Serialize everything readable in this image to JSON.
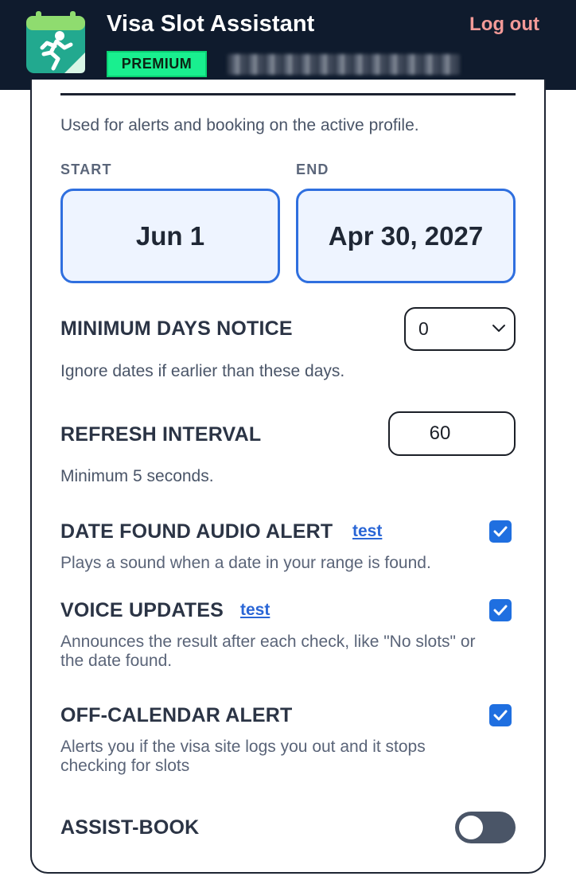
{
  "header": {
    "app_title": "Visa Slot Assistant",
    "badge": "PREMIUM",
    "logout_label": "Log out",
    "logo_icon": "runner-calendar-icon",
    "colors": {
      "background": "#0f1b2d",
      "badge": "#19ef8f",
      "logout": "#f39a98"
    }
  },
  "dates": {
    "help": "Used for alerts and booking on the active profile.",
    "start_label": "START",
    "end_label": "END",
    "start_value": "Jun 1",
    "end_value": "Apr 30, 2027"
  },
  "min_days": {
    "label": "MINIMUM DAYS NOTICE",
    "value": "0",
    "help": "Ignore dates if earlier than these days."
  },
  "refresh": {
    "label": "REFRESH INTERVAL",
    "value": "60",
    "help": "Minimum 5 seconds."
  },
  "audio_alert": {
    "label": "DATE FOUND AUDIO ALERT",
    "link": "test",
    "checked": true,
    "help": "Plays a sound when a date in your range is found."
  },
  "voice": {
    "label": "VOICE UPDATES",
    "link": "test",
    "checked": true,
    "help_line1": "Announces the result after each check, like \"No slots\" or",
    "help_line2": "the date found."
  },
  "off_calendar": {
    "label": "OFF-CALENDAR ALERT",
    "checked": true,
    "help_line1": "Alerts you if the visa site logs you out and it stops",
    "help_line2": "checking for slots"
  },
  "assist_book": {
    "label": "ASSIST-BOOK",
    "enabled": false
  }
}
